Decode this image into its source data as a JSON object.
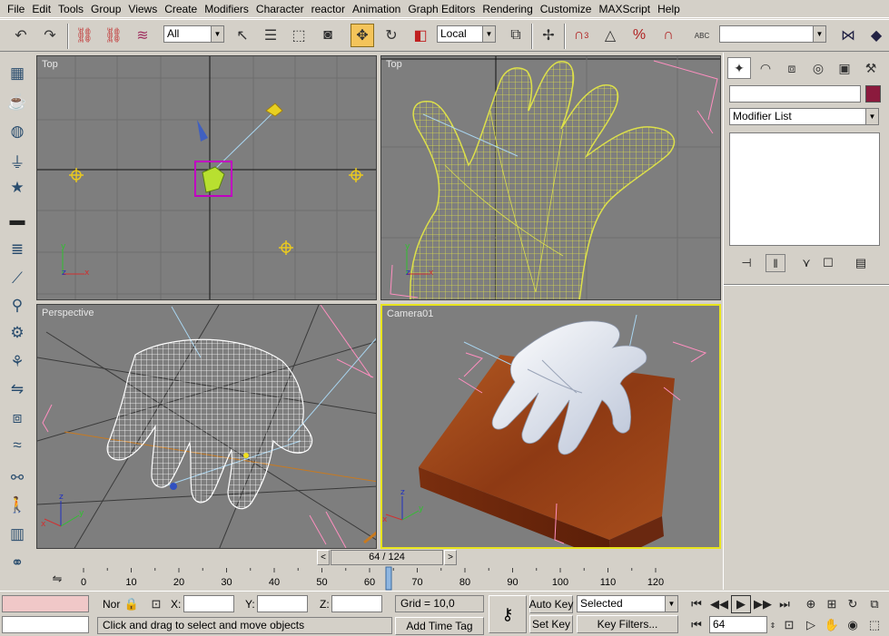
{
  "menu": [
    "File",
    "Edit",
    "Tools",
    "Group",
    "Views",
    "Create",
    "Modifiers",
    "Character",
    "reactor",
    "Animation",
    "Graph Editors",
    "Rendering",
    "Customize",
    "MAXScript",
    "Help"
  ],
  "toolbar": {
    "selection_filter": "All",
    "coord_system": "Local",
    "named_selection": "",
    "angle_snap_label": "3",
    "percent_snap_label": "%",
    "text_label": "ABC"
  },
  "viewports": {
    "top_left": {
      "label": "Top"
    },
    "top_right": {
      "label": "Top"
    },
    "bottom_left": {
      "label": "Perspective"
    },
    "bottom_right": {
      "label": "Camera01"
    }
  },
  "command_panel": {
    "object_name": "",
    "object_color": "#8b1a3d",
    "modifier_list": "Modifier List"
  },
  "time_slider": {
    "label": "64 / 124",
    "current_frame": 64,
    "total_frames": 124,
    "ticks": [
      "0",
      "10",
      "20",
      "30",
      "40",
      "50",
      "60",
      "70",
      "80",
      "90",
      "100",
      "110",
      "120"
    ]
  },
  "status": {
    "lock_label": "Nor",
    "x_label": "X:",
    "y_label": "Y:",
    "z_label": "Z:",
    "x_value": "",
    "y_value": "",
    "z_value": "",
    "grid": "Grid = 10,0",
    "prompt": "Click and drag to select and move objects",
    "add_time_tag": "Add Time Tag",
    "auto_key": "Auto Key",
    "set_key": "Set Key",
    "key_mode": "Selected",
    "key_filters": "Key Filters...",
    "frame": "64"
  },
  "colors": {
    "viewport_bg": "#7e7e7e",
    "active_border": "#e8e41c",
    "wire_yellow": "#dde04a",
    "wire_white": "#ffffff",
    "camera_pink": "#ff8fc0",
    "wood": "#a0441a",
    "hand_skin": "#d8dde8",
    "highlight_btn": "#f4c45a"
  }
}
